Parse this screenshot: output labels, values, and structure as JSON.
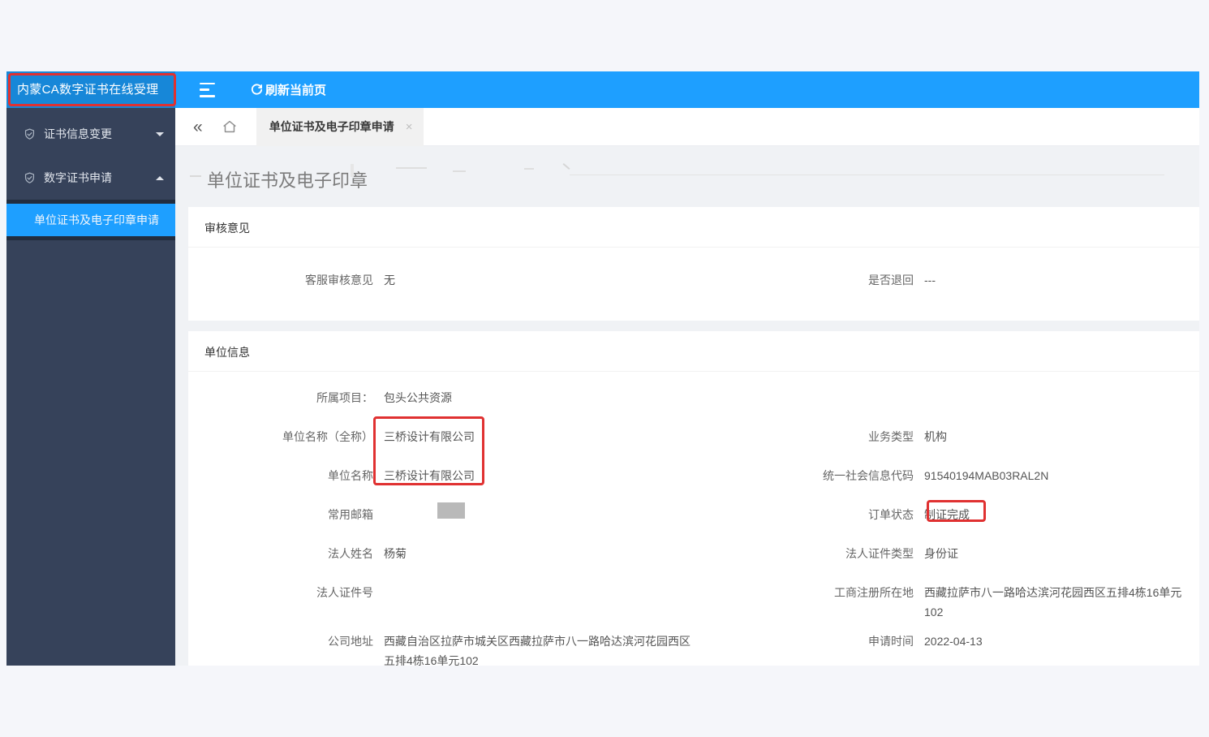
{
  "app": {
    "brand": "内蒙CA数字证书在线受理",
    "topbar": {
      "refresh_label": "刷新当前页"
    },
    "tabbar": {
      "back_icon": "«",
      "active_tab": "单位证书及电子印章申请",
      "close_icon": "×"
    }
  },
  "sidebar": {
    "menu": [
      {
        "label": "证书信息变更",
        "state": "collapsed"
      },
      {
        "label": "数字证书申请",
        "state": "expanded"
      }
    ],
    "submenu": {
      "active_item": "单位证书及电子印章申请"
    }
  },
  "main": {
    "page_title": "单位证书及电子印章",
    "audit": {
      "section_title": "审核意见",
      "left": {
        "label": "客服审核意见",
        "value": "无"
      },
      "right": {
        "label": "是否退回",
        "value": "---"
      }
    },
    "unit": {
      "section_title": "单位信息",
      "project": {
        "label": "所属项目：",
        "value": "包头公共资源"
      },
      "rows": [
        {
          "left": {
            "label": "单位名称（全称）",
            "value": "三桥设计有限公司"
          },
          "right": {
            "label": "业务类型",
            "value": "机构"
          }
        },
        {
          "left": {
            "label": "单位名称",
            "value": "三桥设计有限公司"
          },
          "right": {
            "label": "统一社会信息代码",
            "value": "91540194MAB03RAL2N"
          }
        },
        {
          "left": {
            "label": "常用邮箱",
            "value": ""
          },
          "right": {
            "label": "订单状态",
            "value": "制证完成"
          }
        },
        {
          "left": {
            "label": "法人姓名",
            "value": "杨菊"
          },
          "right": {
            "label": "法人证件类型",
            "value": "身份证"
          }
        },
        {
          "left": {
            "label": "法人证件号",
            "value": ""
          },
          "right": {
            "label": "工商注册所在地",
            "value": "西藏拉萨市八一路哈达滨河花园西区五排4栋16单元102"
          }
        },
        {
          "left": {
            "label": "公司地址",
            "value": "西藏自治区拉萨市城关区西藏拉萨市八一路哈达滨河花园西区五排4栋16单元102"
          },
          "right": {
            "label": "申请时间",
            "value": "2022-04-13"
          }
        }
      ]
    }
  },
  "annotations": {
    "highlight_color": "#e03131",
    "boxed_items": [
      "内蒙CA数字证书在线受理",
      "三桥设计有限公司",
      "制证完成"
    ],
    "redacted_fields": [
      "常用邮箱"
    ]
  },
  "colors": {
    "accent_blue": "#1e9fff",
    "sidebar_header_blue": "#1787d8",
    "sidebar_navy": "#36425a",
    "submenu_dark": "#222d3f",
    "page_background": "#f0f2f5"
  }
}
